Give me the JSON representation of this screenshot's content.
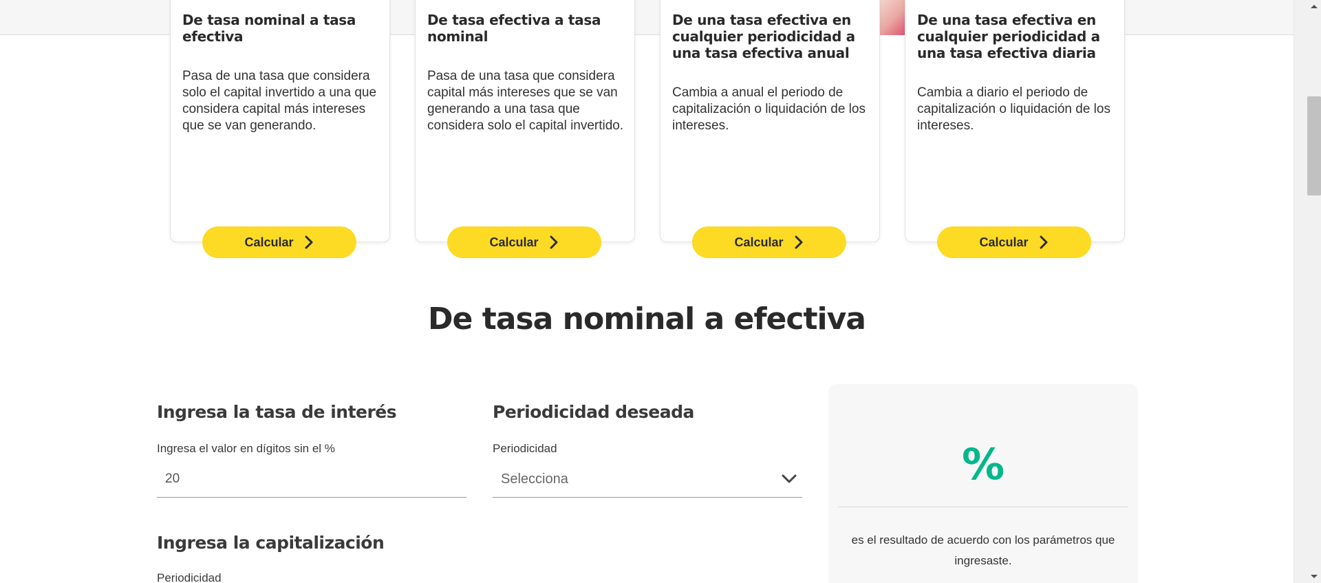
{
  "cards": [
    {
      "title": "De tasa nominal a tasa efectiva",
      "description": "Pasa de una tasa que considera solo el capital invertido a una que considera capital más intereses que se van generando.",
      "button_label": "Calcular"
    },
    {
      "title": "De tasa efectiva a tasa nominal",
      "description": "Pasa de una tasa que considera capital más intereses que se van generando a una tasa que considera solo el capital invertido.",
      "button_label": "Calcular"
    },
    {
      "title": "De una tasa efectiva en cualquier periodicidad a una tasa efectiva anual",
      "description": "Cambia a anual el periodo de capitalización o liquidación de los intereses.",
      "button_label": "Calcular"
    },
    {
      "title": "De una tasa efectiva en cualquier periodicidad a una tasa efectiva diaria",
      "description": "Cambia a diario el periodo de capitalización o liquidación de los intereses.",
      "button_label": "Calcular"
    }
  ],
  "calculator": {
    "title": "De tasa nominal a efectiva",
    "rate_heading": "Ingresa la tasa de interés",
    "rate_label": "Ingresa el valor en dígitos sin el %",
    "rate_value": "20",
    "period_heading": "Periodicidad deseada",
    "period_label": "Periodicidad",
    "period_value": "Selecciona",
    "capitalization_heading": "Ingresa la capitalización",
    "capitalization_label": "Periodicidad"
  },
  "result": {
    "symbol": "%",
    "text": "es el resultado de acuerdo con los parámetros que ingresaste."
  },
  "colors": {
    "accent_yellow": "#fdda24",
    "result_green": "#00b88a",
    "text_dark": "#2a2a2a"
  }
}
